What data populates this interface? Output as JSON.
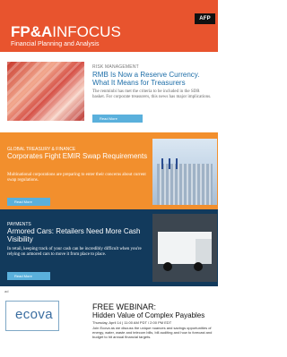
{
  "header": {
    "logo": "AFP",
    "brand_fpa": "FP&A",
    "brand_infocus": "INFOCUS",
    "subtitle": "Financial Planning and Analysis"
  },
  "articles": [
    {
      "kicker": "RISK MANAGEMENT",
      "title": "RMB Is Now a Reserve Currency. What It Means for Treasurers",
      "desc": "The renminbi has met the criteria to be included in the SDR basket. For corporate treasurers, this news has major implications.",
      "button": "Read More"
    },
    {
      "kicker": "GLOBAL TREASURY & FINANCE",
      "title": "Corporates Fight EMIR Swap Requirements",
      "desc": "Multinational corporations are preparing to enter their concerns about current swap regulations.",
      "button": "Read More"
    },
    {
      "kicker": "PAYMENTS",
      "title": "Armored Cars: Retailers Need More Cash Visibility",
      "desc": "In retail, keeping track of your cash can be incredibly difficult when you're relying on armored cars to move it from place to place.",
      "button": "Read More"
    }
  ],
  "ad": {
    "tag": "ad",
    "logo": "ecova",
    "title_line1": "FREE WEBINAR:",
    "title_line2": "Hidden Value of Complex Payables",
    "date": "Thursday, April 14 | 11:00 AM PDT / 2:00 PM EDT",
    "body": "Join Ecova as we discuss the unique nuances and savings opportunities of energy, water, waste and telecom bills, bill auditing and how to forecast and budget to hit annual financial targets."
  }
}
